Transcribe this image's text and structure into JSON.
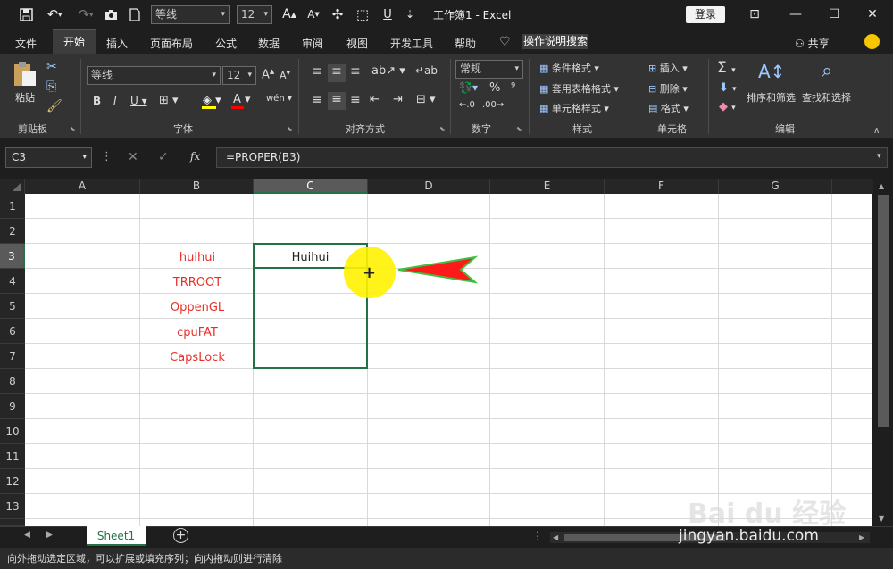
{
  "titlebar": {
    "font_name": "等线",
    "font_size": "12",
    "title": "工作簿1 - Excel",
    "login": "登录"
  },
  "menu": {
    "tabs": [
      "文件",
      "开始",
      "插入",
      "页面布局",
      "公式",
      "数据",
      "审阅",
      "视图",
      "开发工具",
      "帮助"
    ],
    "search": "操作说明搜索",
    "share": "共享"
  },
  "ribbon": {
    "paste": "粘贴",
    "font_name": "等线",
    "font_size": "12",
    "number_format": "常规",
    "cond_format": "条件格式",
    "table_format": "套用表格格式",
    "cell_style": "单元格样式",
    "insert": "插入",
    "delete": "删除",
    "format": "格式",
    "sort_filter": "排序和筛选",
    "find_select": "查找和选择",
    "groups": [
      "剪贴板",
      "字体",
      "对齐方式",
      "数字",
      "样式",
      "单元格",
      "编辑"
    ]
  },
  "formula": {
    "name_box": "C3",
    "fx": "fx",
    "value": "=PROPER(B3)"
  },
  "columns": [
    "A",
    "B",
    "C",
    "D",
    "E",
    "F",
    "G"
  ],
  "rows": [
    "1",
    "2",
    "3",
    "4",
    "5",
    "6",
    "7",
    "8",
    "9",
    "10",
    "11",
    "12",
    "13"
  ],
  "cells": {
    "B": [
      "huihui",
      "TRROOT",
      "OppenGL",
      "cpuFAT",
      "CapsLock"
    ],
    "C3": "Huihui"
  },
  "sheet": {
    "tab": "Sheet1"
  },
  "status": "向外拖动选定区域，可以扩展或填充序列；向内拖动则进行清除",
  "watermark": {
    "logo": "Bai du 经验",
    "url": "jingyan.baidu.com"
  },
  "colors": {
    "accent": "#217346",
    "red_text": "#e8302a",
    "arrow": "#ff1a1a",
    "highlight": "#fff200"
  }
}
